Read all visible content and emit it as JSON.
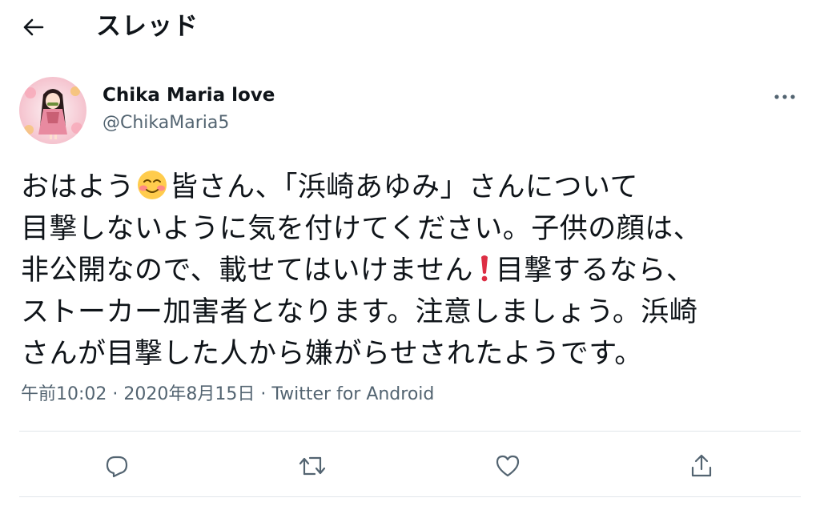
{
  "header": {
    "title": "スレッド",
    "back_icon": "arrow-left-icon"
  },
  "tweet": {
    "author": {
      "name": "Chika Maria love",
      "handle": "@ChikaMaria5"
    },
    "text_lines": [
      {
        "before": "おはよう",
        "emoji": "smiling-face-icon",
        "after": "皆さん、「浜崎あゆみ」さんについて"
      },
      {
        "text": "目撃しないように気を付けてください。子供の顔は、"
      },
      {
        "before": "非公開なので、載せてはいけません",
        "emoji": "exclamation-icon",
        "after": "目撃するなら、"
      },
      {
        "text": "ストーカー加害者となります。注意しましょう。浜崎"
      },
      {
        "text": "さんが目撃した人から嫌がらせされたようです。"
      }
    ],
    "timestamp": "午前10:02 · 2020年8月15日 · ",
    "source": "Twitter for Android"
  },
  "actions": {
    "reply_icon": "reply-icon",
    "retweet_icon": "retweet-icon",
    "like_icon": "heart-icon",
    "share_icon": "share-icon"
  },
  "colors": {
    "text": "#0f1419",
    "secondary": "#536471",
    "divider": "#e1e6ea",
    "exclamation": "#dd2e44"
  }
}
